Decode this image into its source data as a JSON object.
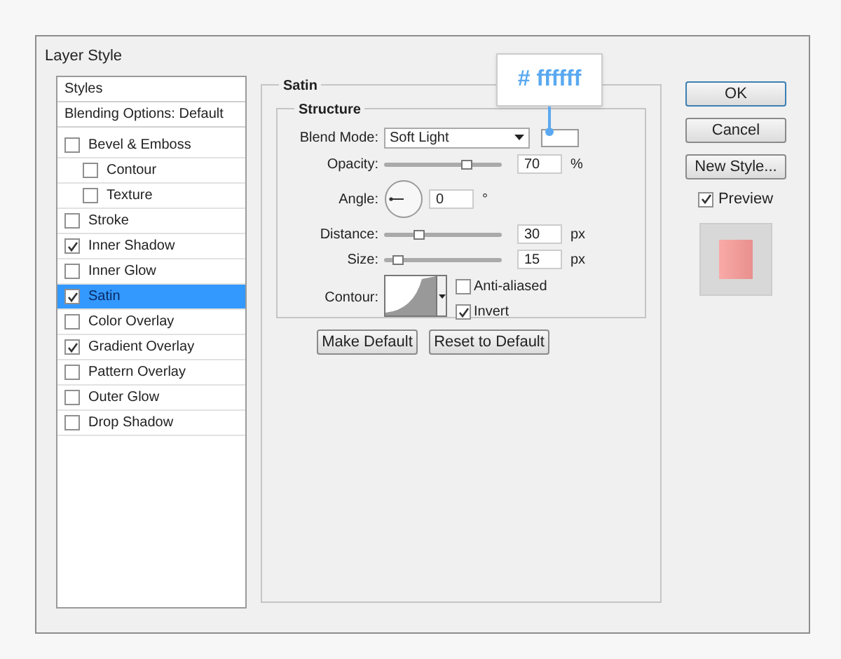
{
  "window": {
    "title": "Layer Style"
  },
  "styles_panel": {
    "header": "Styles",
    "blending_options": "Blending Options: Default",
    "effects": [
      {
        "label": "Bevel & Emboss",
        "checked": false,
        "selected": false,
        "children": [
          {
            "label": "Contour",
            "checked": false,
            "selected": false
          },
          {
            "label": "Texture",
            "checked": false,
            "selected": false
          }
        ]
      },
      {
        "label": "Stroke",
        "checked": false,
        "selected": false
      },
      {
        "label": "Inner Shadow",
        "checked": true,
        "selected": false
      },
      {
        "label": "Inner Glow",
        "checked": false,
        "selected": false
      },
      {
        "label": "Satin",
        "checked": true,
        "selected": true
      },
      {
        "label": "Color Overlay",
        "checked": false,
        "selected": false
      },
      {
        "label": "Gradient Overlay",
        "checked": true,
        "selected": false
      },
      {
        "label": "Pattern Overlay",
        "checked": false,
        "selected": false
      },
      {
        "label": "Outer Glow",
        "checked": false,
        "selected": false
      },
      {
        "label": "Drop Shadow",
        "checked": false,
        "selected": false
      }
    ]
  },
  "satin": {
    "title": "Satin",
    "group_title": "Structure",
    "blend_mode": {
      "label": "Blend Mode:",
      "value": "Soft Light",
      "color": "#ffffff"
    },
    "color_tooltip": "# ffffff",
    "rows": [
      {
        "kind": "slider",
        "label": "Opacity:",
        "level": 0.7,
        "value": "70",
        "unit": "%"
      },
      {
        "kind": "angle",
        "label": "Angle:",
        "value": "0",
        "unit": "°"
      },
      {
        "kind": "slider",
        "label": "Distance:",
        "level": 0.3,
        "value": "30",
        "unit": "px"
      },
      {
        "kind": "slider",
        "label": "Size:",
        "level": 0.12,
        "value": "15",
        "unit": "px"
      }
    ],
    "contour": {
      "label": "Contour:"
    },
    "options": [
      {
        "label": "Anti-aliased",
        "checked": false
      },
      {
        "label": "Invert",
        "checked": true
      }
    ],
    "buttons": [
      "Make Default",
      "Reset to Default"
    ]
  },
  "actions": {
    "buttons": [
      {
        "label": "OK",
        "default": true
      },
      {
        "label": "Cancel",
        "default": false
      },
      {
        "label": "New Style...",
        "default": false
      }
    ],
    "preview": {
      "label": "Preview",
      "checked": true
    }
  }
}
